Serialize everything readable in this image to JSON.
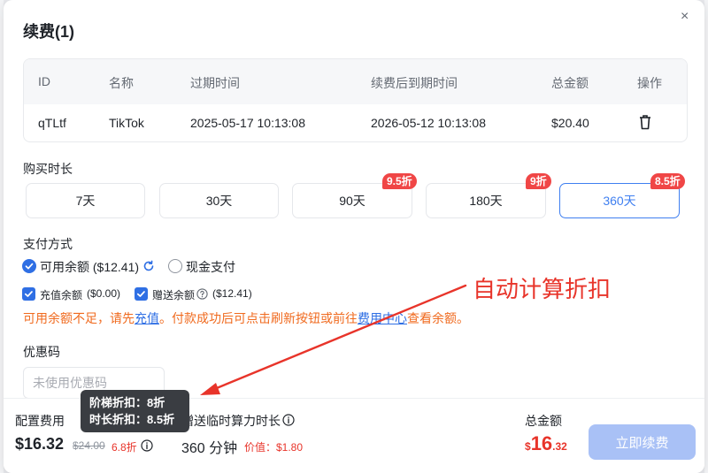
{
  "modal": {
    "title": "续费(1)",
    "close_symbol": "×"
  },
  "table": {
    "headers": [
      "ID",
      "名称",
      "过期时间",
      "续费后到期时间",
      "总金额",
      "操作"
    ],
    "row": {
      "id": "qTLtf",
      "name": "TikTok",
      "expire": "2025-05-17 10:13:08",
      "new_expire": "2026-05-12 10:13:08",
      "amount": "$20.40"
    }
  },
  "duration": {
    "label": "购买时长",
    "options": [
      {
        "label": "7天",
        "badge": ""
      },
      {
        "label": "30天",
        "badge": ""
      },
      {
        "label": "90天",
        "badge": "9.5折"
      },
      {
        "label": "180天",
        "badge": "9折"
      },
      {
        "label": "360天",
        "badge": "8.5折",
        "selected": true
      }
    ]
  },
  "payment": {
    "label": "支付方式",
    "balance_label": "可用余额 ($12.41)",
    "cash_label": "现金支付",
    "recharge_label": "充值余额",
    "recharge_value": "($0.00)",
    "gift_label": "赠送余额",
    "gift_value": "($12.41)",
    "warning_prefix": "可用余额不足，请先",
    "warning_link1": "充值",
    "warning_mid": "。付款成功后可点击刷新按钮或前往",
    "warning_link2": "费用中心",
    "warning_suffix": "查看余额。"
  },
  "coupon": {
    "label": "优惠码",
    "placeholder": "未使用优惠码"
  },
  "footer": {
    "config_label": "配置费用",
    "config_price": "$16.32",
    "config_original": "$24.00",
    "config_discount": "6.8折",
    "bonus_label": "赠送临时算力时长",
    "bonus_value": "360 分钟",
    "bonus_worth": "价值：$1.80",
    "total_label": "总金额",
    "total_currency": "$",
    "total_int": "16",
    "total_dec": ".32",
    "pay_button": "立即续费"
  },
  "tooltip": {
    "line1": "阶梯折扣：8折",
    "line2": "时长折扣：8.5折"
  },
  "annotation": {
    "text": "自动计算折扣",
    "color": "#e8342a"
  },
  "colors": {
    "primary": "#2f6fe4",
    "danger": "#f04646",
    "warning": "#f06a1e",
    "price": "#e8342a"
  }
}
